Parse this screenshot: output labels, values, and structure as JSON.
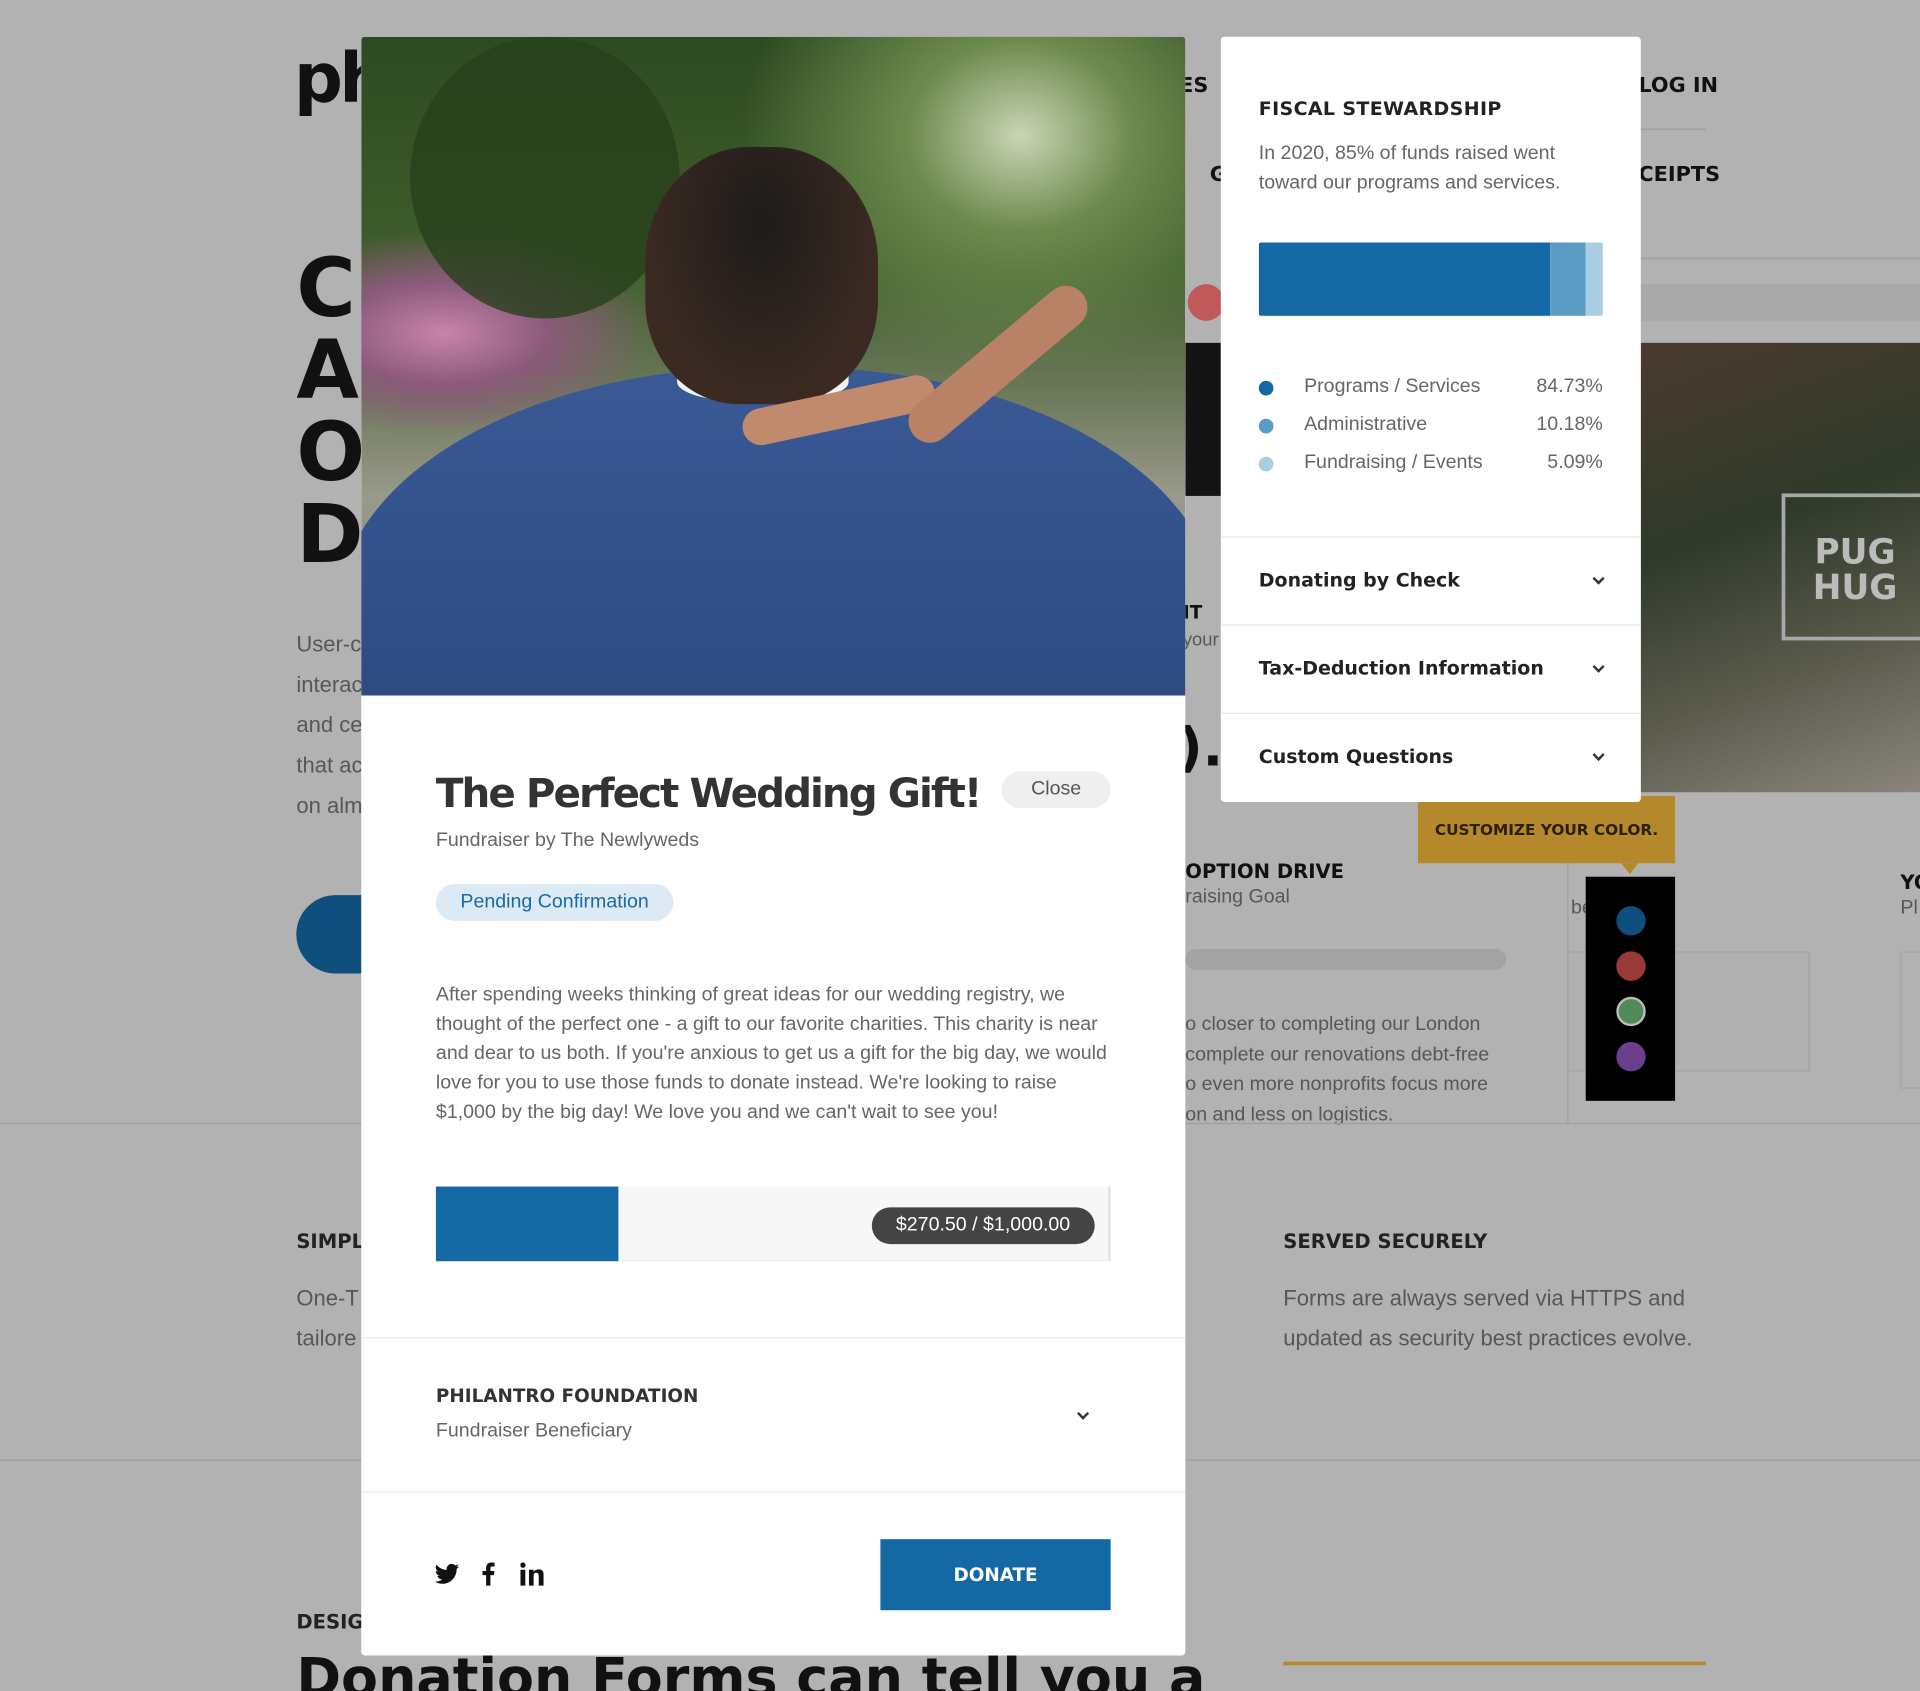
{
  "background": {
    "logo": "ph",
    "hero_letters": [
      "C",
      "A",
      "O",
      "D"
    ],
    "hero_paragraph": [
      "User-c",
      "interac",
      "and ce",
      "that ac",
      "on alm"
    ],
    "nav": {
      "item_partial": "ES",
      "login": "LOG IN",
      "item2_partial": "G",
      "receipts_partial": "CEIPTS"
    },
    "form_partial": {
      "heading": "IT",
      "sub": "your",
      "amount": ").("
    },
    "pug_label": [
      "PUG",
      "HUG"
    ],
    "adoption_drive": {
      "title": "OPTION DRIVE",
      "subtitle": "raising Goal",
      "text": [
        "o closer to completing our London",
        "complete our renovations debt-free",
        "o even more nonprofits focus more",
        "on and less on logistics."
      ]
    },
    "side_partial": {
      "a": "be",
      "b": "YO",
      "c": "Pl"
    },
    "tooltip": "CUSTOMIZE YOUR COLOR.",
    "swatches": [
      "#0e4f7e",
      "#9a3a36",
      "#4f8a57",
      "#6c3f8e"
    ],
    "features": [
      {
        "title": "SIMPL",
        "text": [
          "One-T",
          "tailore"
        ]
      },
      {
        "title": "SERVED SECURELY",
        "text": [
          "Forms are always served via HTTPS and",
          "updated as security best practices evolve."
        ]
      }
    ],
    "design": {
      "label": "DESIG",
      "heading": "Donation Forms can tell you a"
    }
  },
  "modal": {
    "title": "The Perfect Wedding Gift!",
    "close_label": "Close",
    "subtitle": "Fundraiser by The Newlyweds",
    "status": "Pending Confirmation",
    "description": "After spending weeks thinking of great ideas for our wedding registry, we thought of the perfect one - a gift to our favorite charities. This charity is near and dear to us both. If you're anxious to get us a gift for the big day, we would love for you to use those funds to donate instead. We're looking to raise $1,000 by the big day! We love you and we can't wait to see you!",
    "progress": {
      "raised": 270.5,
      "goal": 1000.0,
      "label": "$270.50 / $1,000.00"
    },
    "beneficiary": {
      "name": "PHILANTRO FOUNDATION",
      "label": "Fundraiser Beneficiary"
    },
    "social": [
      "twitter-icon",
      "facebook-icon",
      "linkedin-icon"
    ],
    "donate_label": "DONATE",
    "accent": "#1469a5"
  },
  "panel": {
    "title": "FISCAL STEWARDSHIP",
    "text": "In 2020, 85% of funds raised went toward our programs and services.",
    "breakdown": [
      {
        "label": "Programs / Services",
        "value": "84.73%",
        "pct": 84.73,
        "color": "#1469a5"
      },
      {
        "label": "Administrative",
        "value": "10.18%",
        "pct": 10.18,
        "color": "#5b9cc5"
      },
      {
        "label": "Fundraising / Events",
        "value": "5.09%",
        "pct": 5.09,
        "color": "#a9cde3"
      }
    ],
    "accordions": [
      "Donating by Check",
      "Tax-Deduction Information",
      "Custom Questions"
    ]
  }
}
